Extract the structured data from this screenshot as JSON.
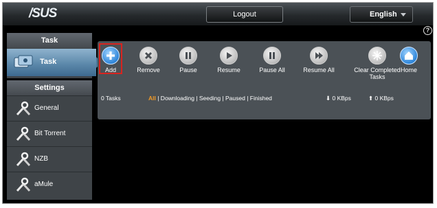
{
  "header": {
    "logo": "/SUS",
    "logout_label": "Logout",
    "language": "English",
    "help_symbol": "?"
  },
  "sidebar": {
    "task_section": "Task",
    "task_item": "Task",
    "settings_section": "Settings",
    "settings_items": [
      {
        "label": "General",
        "icon": "tools-icon"
      },
      {
        "label": "Bit Torrent",
        "icon": "tools-icon"
      },
      {
        "label": "NZB",
        "icon": "tools-icon"
      },
      {
        "label": "aMule",
        "icon": "tools-icon"
      }
    ]
  },
  "toolbar": {
    "buttons": [
      {
        "label": "Add",
        "icon": "plus-icon"
      },
      {
        "label": "Remove",
        "icon": "x-icon"
      },
      {
        "label": "Pause",
        "icon": "pause-icon"
      },
      {
        "label": "Resume",
        "icon": "play-icon"
      },
      {
        "label": "Pause All",
        "icon": "pause-icon"
      },
      {
        "label": "Resume All",
        "icon": "fast-forward-icon"
      },
      {
        "label": "Clear Completed Tasks",
        "icon": "clear-icon"
      },
      {
        "label": "Home",
        "icon": "home-icon"
      }
    ]
  },
  "status": {
    "task_count": "0 Tasks",
    "filter_all": "All",
    "filter_rest": " | Downloading | Seeding | Paused | Finished",
    "download_rate": "0 KBps",
    "upload_rate": "0 KBps"
  },
  "colors": {
    "accent": "#f29a26",
    "highlight": "#d9241f",
    "active_item": "#5d89ab"
  }
}
